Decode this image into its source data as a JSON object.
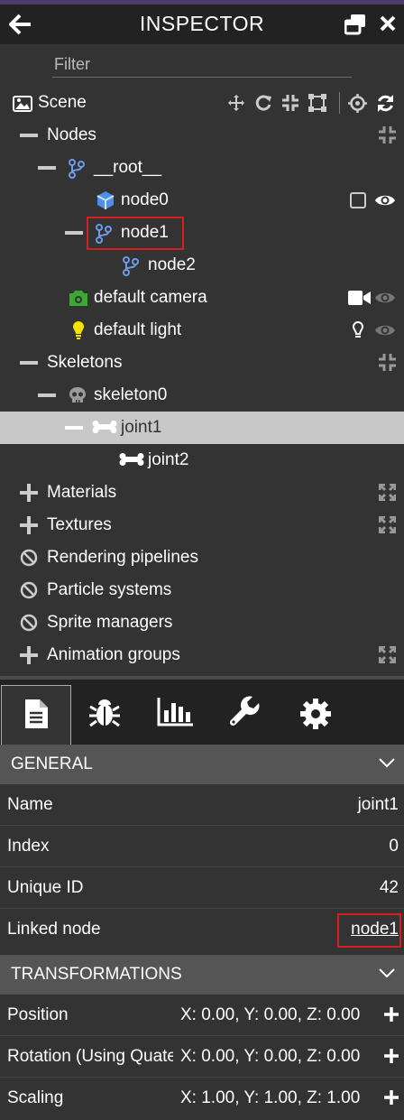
{
  "header": {
    "title": "INSPECTOR"
  },
  "filter": {
    "placeholder": "Filter"
  },
  "tree": {
    "scene": "Scene",
    "nodes": "Nodes",
    "root": "__root__",
    "node0": "node0",
    "node1": "node1",
    "node2": "node2",
    "camera": "default camera",
    "light": "default light",
    "skeletons": "Skeletons",
    "skeleton0": "skeleton0",
    "joint1": "joint1",
    "joint2": "joint2",
    "materials": "Materials",
    "textures": "Textures",
    "pipelines": "Rendering pipelines",
    "particles": "Particle systems",
    "sprites": "Sprite managers",
    "animations": "Animation groups"
  },
  "general": {
    "title": "GENERAL",
    "name_label": "Name",
    "name_value": "joint1",
    "index_label": "Index",
    "index_value": "0",
    "uid_label": "Unique ID",
    "uid_value": "42",
    "linked_label": "Linked node",
    "linked_value": "node1"
  },
  "transformations": {
    "title": "TRANSFORMATIONS",
    "position_label": "Position",
    "position_value": "X: 0.00, Y: 0.00, Z: 0.00",
    "rotation_label": "Rotation (Using Quaternion)",
    "rotation_value": "X: 0.00, Y: 0.00, Z: 0.00",
    "scaling_label": "Scaling",
    "scaling_value": "X: 1.00, Y: 1.00, Z: 1.00"
  },
  "colors": {
    "background": "#333333",
    "header": "#222222",
    "section": "#555555",
    "selected": "#c8c8c8",
    "highlight": "#d62020",
    "node_icon": "#6f9be8",
    "camera_icon": "#3aa832",
    "light_icon": "#f2e300"
  }
}
